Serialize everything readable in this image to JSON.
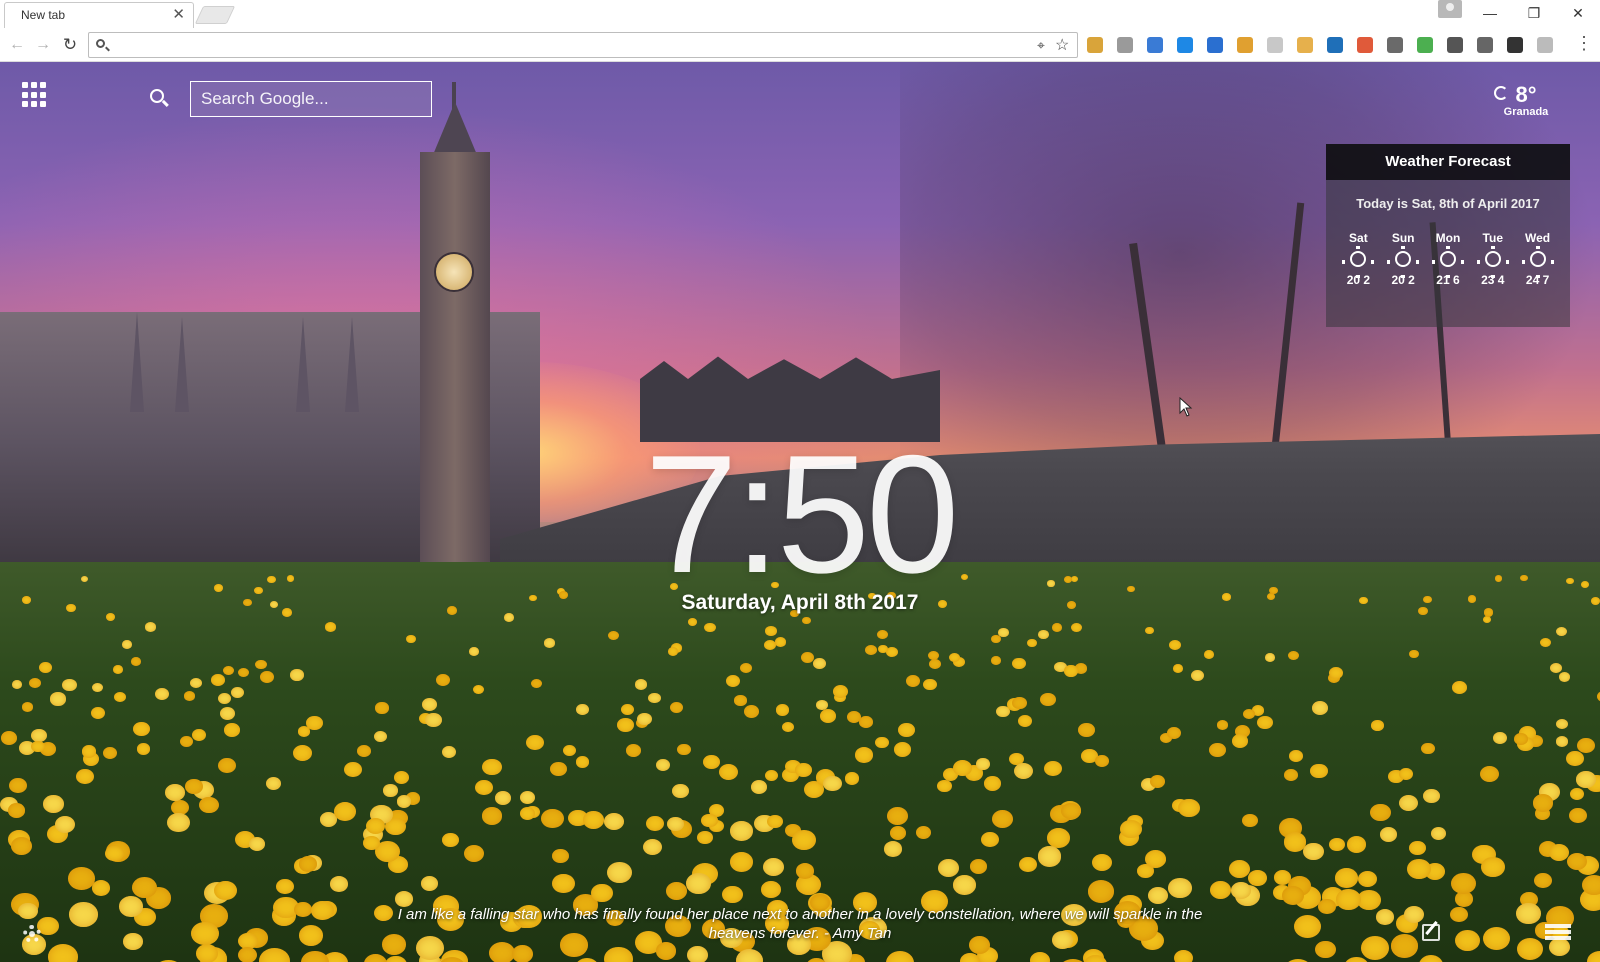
{
  "browser": {
    "tab_title": "New tab",
    "tab_close": "✕",
    "win_minimize": "—",
    "win_restore": "❐",
    "win_close": "✕",
    "nav_back": "←",
    "nav_forward": "→",
    "nav_reload": "↻",
    "address_value": "",
    "location_icon": "⌖",
    "bookmark_icon": "☆",
    "menu_icon": "⋮",
    "extension_colors": [
      "#d9a43a",
      "#9a9a9a",
      "#3a7bd5",
      "#1e88e5",
      "#2a6fd0",
      "#e0a030",
      "#c8c8c8",
      "#e6b04c",
      "#1f6fb8",
      "#e05a3a",
      "#6a6a6a",
      "#4caf50",
      "#555555",
      "#666666",
      "#333333",
      "#bbbbbb"
    ]
  },
  "newtab": {
    "search_placeholder": "Search Google...",
    "weather_small": {
      "temp": "8°",
      "city": "Granada"
    },
    "weather_panel": {
      "title": "Weather Forecast",
      "today": "Today is Sat, 8th of April 2017",
      "days": [
        {
          "name": "Sat",
          "temps": "20 2"
        },
        {
          "name": "Sun",
          "temps": "20 2"
        },
        {
          "name": "Mon",
          "temps": "21 6"
        },
        {
          "name": "Tue",
          "temps": "23 4"
        },
        {
          "name": "Wed",
          "temps": "24 7"
        }
      ]
    },
    "clock": "7:50",
    "date": "Saturday, April 8th 2017",
    "quote": "I am like a falling star who has finally found her place next to another in a lovely constellation, where we will sparkle in the heavens forever. - Amy Tan"
  }
}
